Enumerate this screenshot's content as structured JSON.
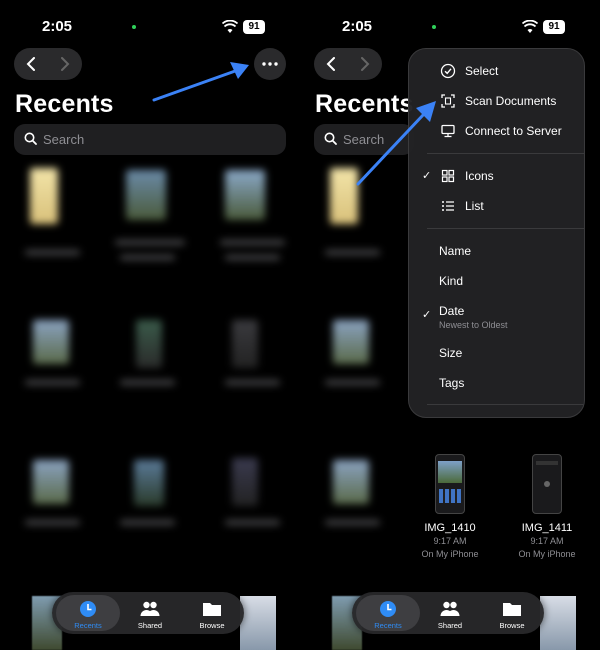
{
  "status": {
    "time": "2:05",
    "battery": "91"
  },
  "title": "Recents",
  "search": {
    "placeholder": "Search"
  },
  "tabs": [
    {
      "label": "Recents",
      "icon": "clock-icon",
      "active": true
    },
    {
      "label": "Shared",
      "icon": "people-icon",
      "active": false
    },
    {
      "label": "Browse",
      "icon": "folder-icon",
      "active": false
    }
  ],
  "menu": {
    "actions": [
      {
        "label": "Select",
        "icon": "checkmark-circle-icon"
      },
      {
        "label": "Scan Documents",
        "icon": "scan-document-icon"
      },
      {
        "label": "Connect to Server",
        "icon": "monitor-icon"
      }
    ],
    "view": [
      {
        "label": "Icons",
        "icon": "grid-icon",
        "checked": true
      },
      {
        "label": "List",
        "icon": "list-icon",
        "checked": false
      }
    ],
    "sort": [
      {
        "label": "Name",
        "checked": false
      },
      {
        "label": "Kind",
        "checked": false
      },
      {
        "label": "Date",
        "checked": true,
        "sublabel": "Newest to Oldest"
      },
      {
        "label": "Size",
        "checked": false
      },
      {
        "label": "Tags",
        "checked": false
      }
    ]
  },
  "files": [
    {
      "name": "IMG_1410",
      "time": "9:17 AM",
      "location": "On My iPhone"
    },
    {
      "name": "IMG_1411",
      "time": "9:17 AM",
      "location": "On My iPhone"
    }
  ],
  "colors": {
    "accent": "#2f8cf5",
    "arrow": "#3b82f6",
    "menu_bg": "#222224"
  }
}
